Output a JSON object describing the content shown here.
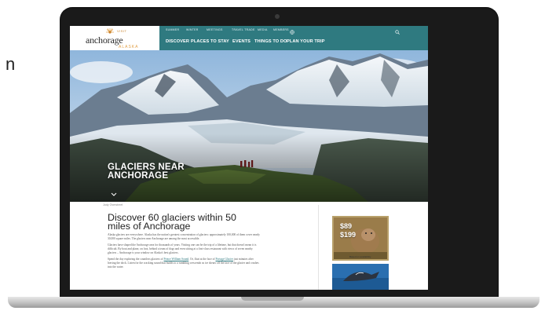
{
  "page": {
    "side_letter": "n"
  },
  "site": {
    "logo": {
      "visit": "VISIT",
      "main": "anchorage",
      "sub": "ALASKA"
    },
    "nav_top": [
      "SUMMER",
      "WINTER",
      "MEETINGS",
      "TRAVEL TRADE",
      "MEDIA",
      "MEMBERS"
    ],
    "nav_main": [
      "DISCOVER",
      "PLACES TO STAY",
      "EVENTS",
      "THINGS TO DO",
      "PLAN YOUR TRIP"
    ],
    "icons": {
      "globe": "globe-icon",
      "search": "search-icon"
    },
    "nav_color": "#2f7a80"
  },
  "hero": {
    "title_line1": "GLACIERS NEAR",
    "title_line2": "ANCHORAGE",
    "credit": "Jody Overstreet"
  },
  "article": {
    "heading": "Discover 60 glaciers within 50 miles of Anchorage",
    "p1": "Alaska glaciers are everywhere. Alaska has the nation's greatest concentration of glaciers: approximately 100,000 of them cover nearly 30,000 square miles. The glaciers near Anchorage are among the most accessible.",
    "p2": "Glaciers have shaped the Anchorage area for thousands of years. Visiting one can be the trip of a lifetime, but that doesn't mean it is difficult. By boat and plane, on foot, behind a team of dogs and even sitting at a first-class restaurant with views of seven nearby glaciers – Anchorage is your window on Alaska's best glaciers.",
    "p3_before": "Spend the day exploring the countless glaciers of ",
    "p3_link1": "Prince William Sound",
    "p3_mid": ". Or, float at the face of ",
    "p3_link2": "Portage Glacier",
    "p3_after": " just minutes after leaving the dock. Listen for the cracking sound that builds to a rumbling crescendo as ice shears off the face of the glacier and crashes into the water."
  },
  "ads": {
    "price1": "$89",
    "price2": "$199",
    "note": "Based on availability"
  }
}
